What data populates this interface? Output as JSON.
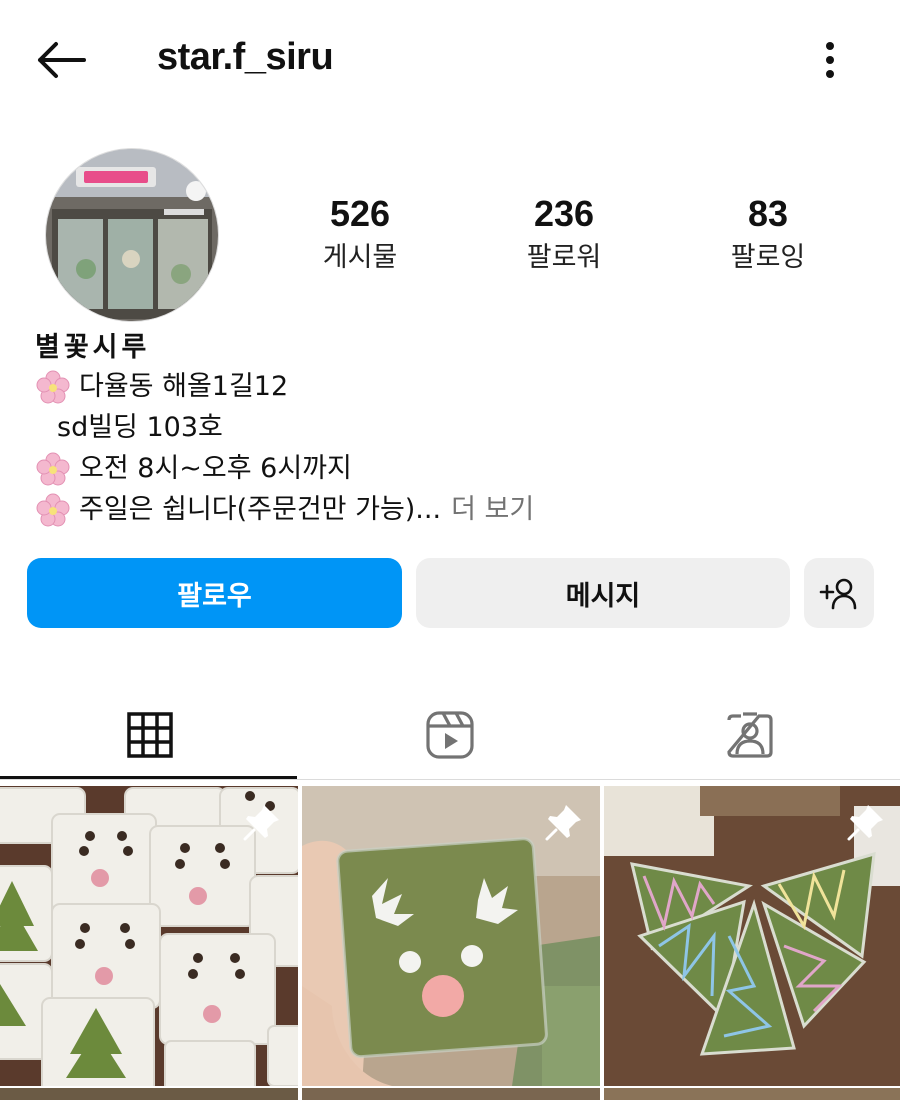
{
  "header": {
    "username": "star.f_siru",
    "back_icon": "arrow-left-icon",
    "more_icon": "more-vertical-icon"
  },
  "profile": {
    "avatar_icon": "store-front-photo",
    "stats": [
      {
        "value": "526",
        "label": "게시물"
      },
      {
        "value": "236",
        "label": "팔로워"
      },
      {
        "value": "83",
        "label": "팔로잉"
      }
    ],
    "bio": {
      "name": "별꽃시루",
      "line1": "다율동 해올1길12",
      "line2": "sd빌딩 103호",
      "line3": "오전 8시~오후 6시까지",
      "line4": "주일은 쉽니다(주문건만 가능)...",
      "more": "더 보기",
      "flower_icon": "cherry-blossom-icon"
    }
  },
  "actions": {
    "follow": "팔로우",
    "message": "메시지",
    "add_person_icon": "add-person-icon"
  },
  "tabs": [
    {
      "icon": "grid-icon",
      "active": true
    },
    {
      "icon": "reels-icon",
      "active": false
    },
    {
      "icon": "tagged-icon",
      "active": false
    }
  ],
  "colors": {
    "follow_button": "#0095f6",
    "secondary_button": "#efefef",
    "muted_text": "#737373"
  },
  "posts": [
    {
      "description_icon": "photo-reindeer-rice-cakes",
      "pinned": true
    },
    {
      "description_icon": "photo-green-reindeer-rice-cake",
      "pinned": true
    },
    {
      "description_icon": "photo-christmas-tree-rice-cakes",
      "pinned": true
    }
  ]
}
